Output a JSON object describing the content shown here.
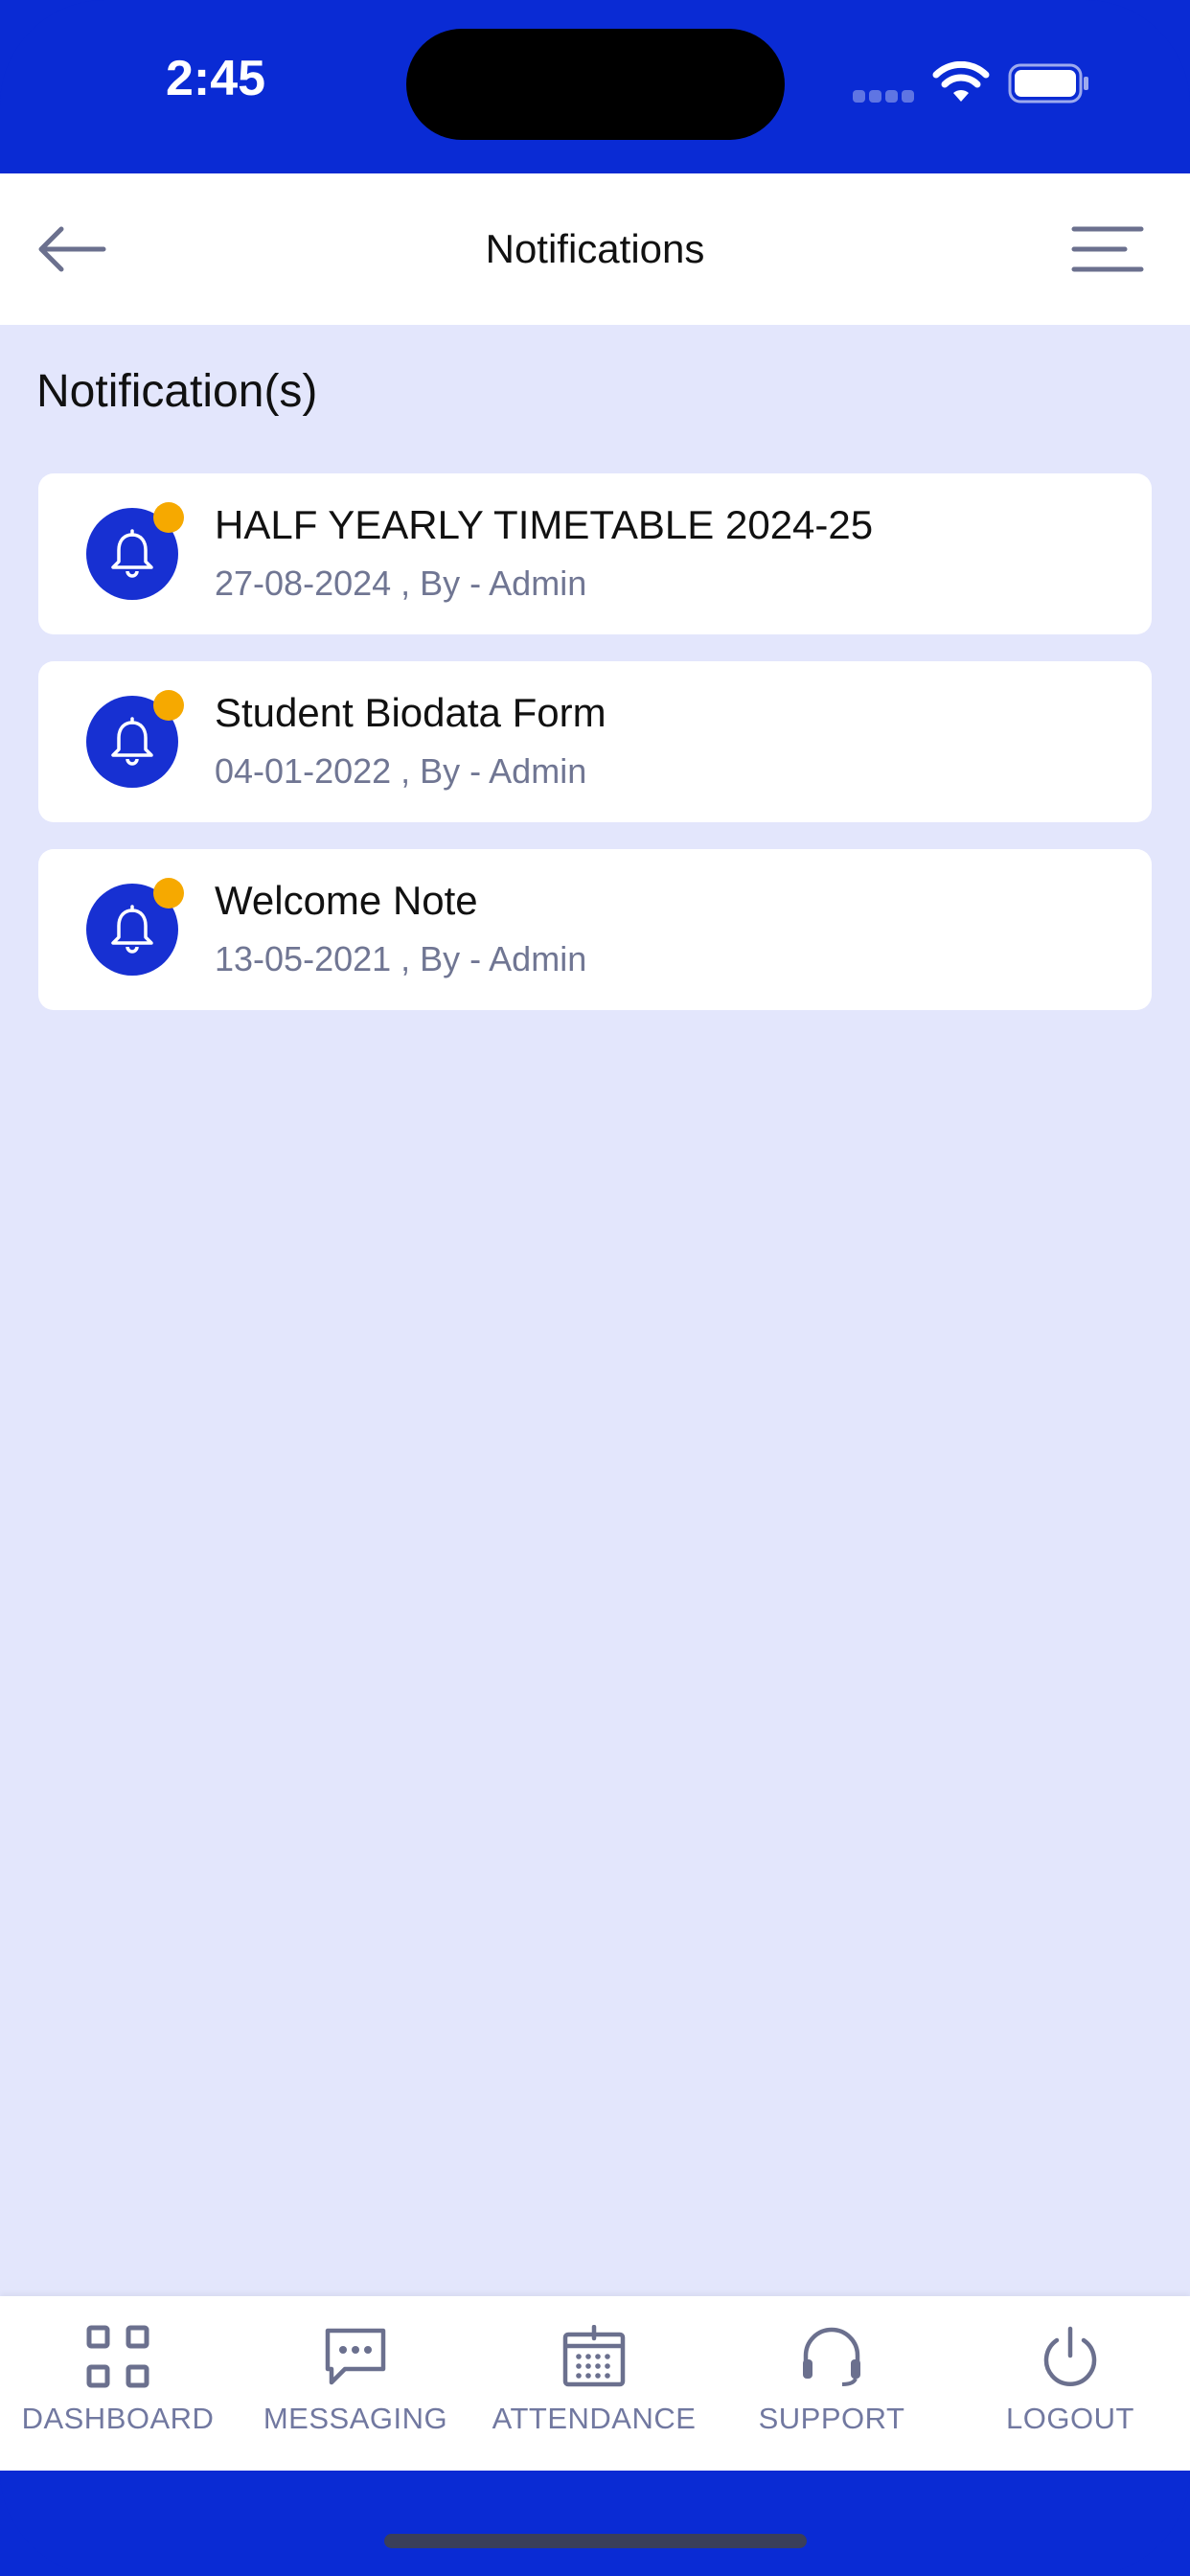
{
  "status_bar": {
    "time": "2:45"
  },
  "header": {
    "title": "Notifications",
    "back_icon": "arrow-left-icon",
    "menu_icon": "menu-icon"
  },
  "section_title": "Notification(s)",
  "notifications": [
    {
      "title": "HALF YEARLY TIMETABLE 2024-25",
      "meta": "27-08-2024 , By - Admin"
    },
    {
      "title": "Student Biodata Form",
      "meta": "04-01-2022 , By - Admin"
    },
    {
      "title": "Welcome Note",
      "meta": "13-05-2021 , By - Admin"
    }
  ],
  "bottom_nav": [
    {
      "label": "DASHBOARD",
      "icon": "grid-icon"
    },
    {
      "label": "MESSAGING",
      "icon": "chat-icon"
    },
    {
      "label": "ATTENDANCE",
      "icon": "calendar-icon"
    },
    {
      "label": "SUPPORT",
      "icon": "headset-icon"
    },
    {
      "label": "LOGOUT",
      "icon": "power-icon"
    }
  ],
  "colors": {
    "primary": "#0a2bd4",
    "badge": "#f6a900",
    "background": "#e3e6fc",
    "muted_text": "#707693"
  }
}
